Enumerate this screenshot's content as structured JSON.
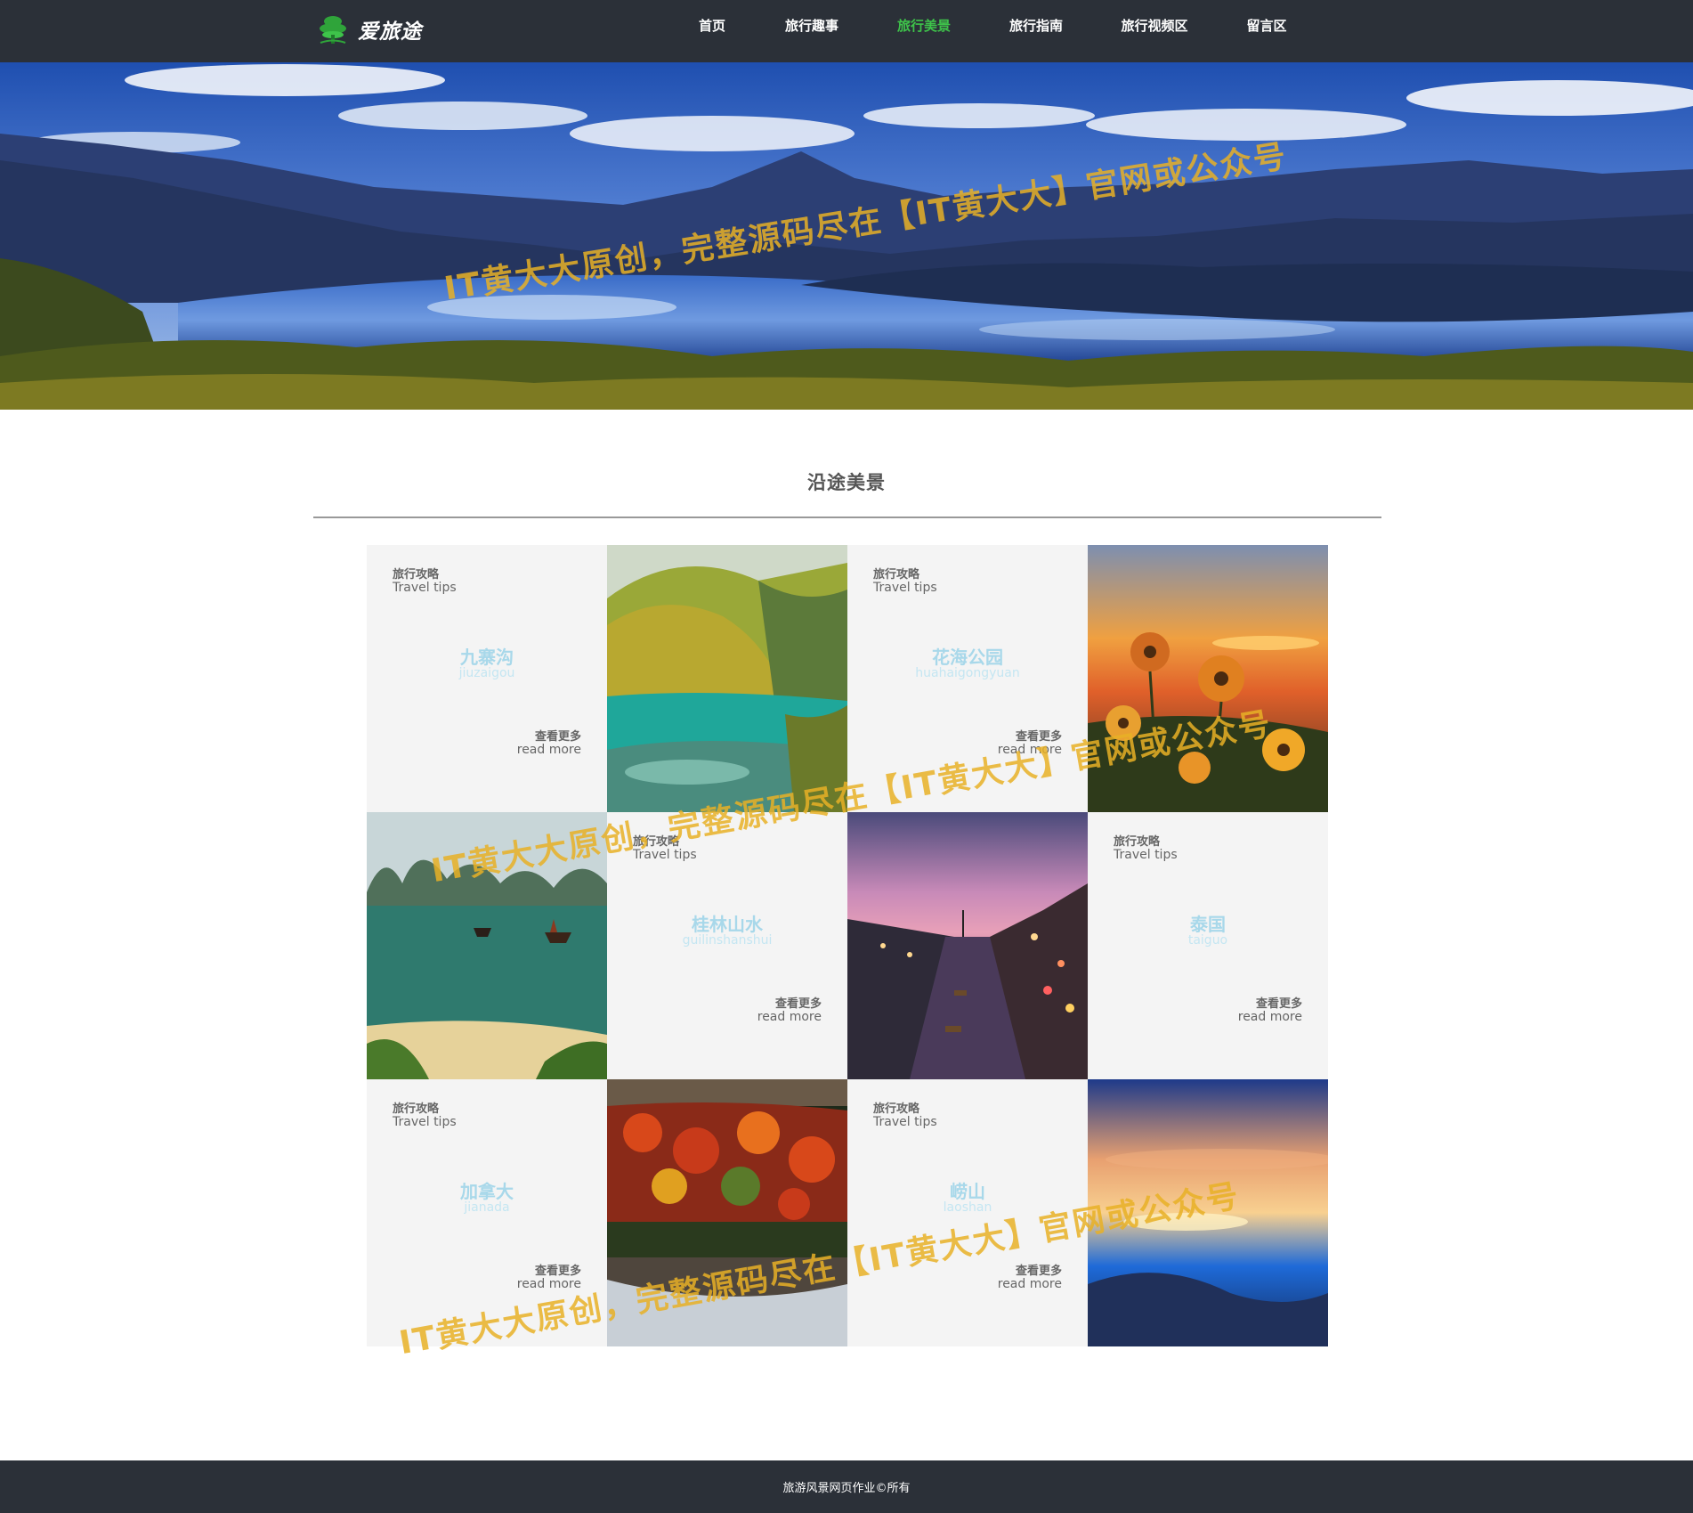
{
  "header": {
    "logo_text": "爱旅途",
    "nav": [
      "首页",
      "旅行趣事",
      "旅行美景",
      "旅行指南",
      "旅行视频区",
      "留言区"
    ],
    "active_nav": "旅行美景"
  },
  "section": {
    "title": "沿途美景"
  },
  "cards": [
    {
      "tip_cn": "旅行攻略",
      "tip_en": "Travel tips",
      "name_cn": "九寨沟",
      "name_en": "jiuzaigou",
      "more_cn": "查看更多",
      "more_en": "read more"
    },
    {
      "tip_cn": "旅行攻略",
      "tip_en": "Travel tips",
      "name_cn": "花海公园",
      "name_en": "huahaigongyuan",
      "more_cn": "查看更多",
      "more_en": "read more"
    },
    {
      "tip_cn": "旅行攻略",
      "tip_en": "Travel tips",
      "name_cn": "桂林山水",
      "name_en": "guilinshanshui",
      "more_cn": "查看更多",
      "more_en": "read more"
    },
    {
      "tip_cn": "旅行攻略",
      "tip_en": "Travel tips",
      "name_cn": "泰国",
      "name_en": "taiguo",
      "more_cn": "查看更多",
      "more_en": "read more"
    },
    {
      "tip_cn": "旅行攻略",
      "tip_en": "Travel tips",
      "name_cn": "加拿大",
      "name_en": "jianada",
      "more_cn": "查看更多",
      "more_en": "read more"
    },
    {
      "tip_cn": "旅行攻略",
      "tip_en": "Travel tips",
      "name_cn": "崂山",
      "name_en": "laoshan",
      "more_cn": "查看更多",
      "more_en": "read more"
    }
  ],
  "watermark": "IT黄大大原创，完整源码尽在【IT黄大大】官网或公众号",
  "footer": {
    "text": "旅游风景网页作业©所有"
  },
  "colors": {
    "nav_bg": "#2b3038",
    "active_nav": "#3ec34a",
    "card_bg": "#f4f4f4",
    "place_name": "#a8d8ea",
    "watermark": "#e7b026"
  }
}
